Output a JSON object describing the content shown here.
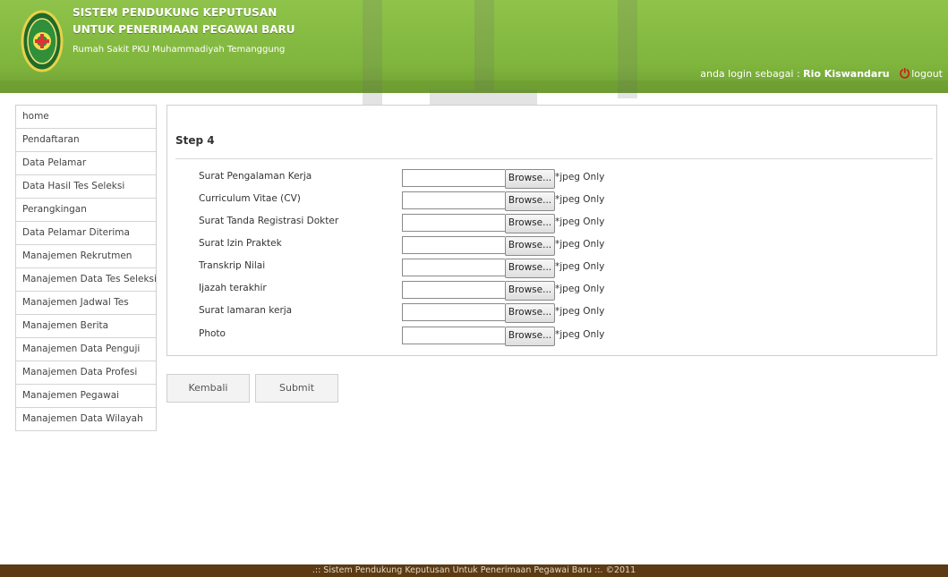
{
  "header": {
    "title_line1": "SISTEM PENDUKUNG KEPUTUSAN",
    "title_line2": "UNTUK PENERIMAAN PEGAWAI BARU",
    "subtitle": "Rumah Sakit PKU Muhammadiyah Temanggung",
    "login_prefix": "anda login sebagai :",
    "username": "Rio Kiswandaru",
    "logout_label": "logout",
    "colors": {
      "bar": "#7fb53d",
      "power": "#cc1c16"
    }
  },
  "sidebar": {
    "items": [
      {
        "label": "home"
      },
      {
        "label": "Pendaftaran"
      },
      {
        "label": "Data Pelamar"
      },
      {
        "label": "Data Hasil Tes Seleksi"
      },
      {
        "label": "Perangkingan"
      },
      {
        "label": "Data Pelamar Diterima"
      },
      {
        "label": "Manajemen Rekrutmen"
      },
      {
        "label": "Manajemen Data Tes Seleksi"
      },
      {
        "label": "Manajemen Jadwal Tes"
      },
      {
        "label": "Manajemen Berita"
      },
      {
        "label": "Manajemen Data Penguji"
      },
      {
        "label": "Manajemen Data Profesi"
      },
      {
        "label": "Manajemen Pegawai"
      },
      {
        "label": "Manajemen Data Wilayah"
      }
    ]
  },
  "form": {
    "step_title": "Step 4",
    "browse_label": "Browse...",
    "note": "*jpeg Only",
    "fields": [
      {
        "label": "Surat Pengalaman Kerja",
        "value": ""
      },
      {
        "label": "Curriculum Vitae (CV)",
        "value": ""
      },
      {
        "label": "Surat Tanda Registrasi Dokter",
        "value": ""
      },
      {
        "label": "Surat Izin Praktek",
        "value": ""
      },
      {
        "label": "Transkrip Nilai",
        "value": ""
      },
      {
        "label": "Ijazah terakhir",
        "value": ""
      },
      {
        "label": "Surat lamaran kerja",
        "value": ""
      },
      {
        "label": "Photo",
        "value": ""
      }
    ]
  },
  "buttons": {
    "back_label": "Kembali",
    "submit_label": "Submit"
  },
  "footer": {
    "text": ".:: Sistem Pendukung Keputusan Untuk Penerimaan Pegawai Baru ::. ©2011",
    "color": "#5b3a14"
  }
}
